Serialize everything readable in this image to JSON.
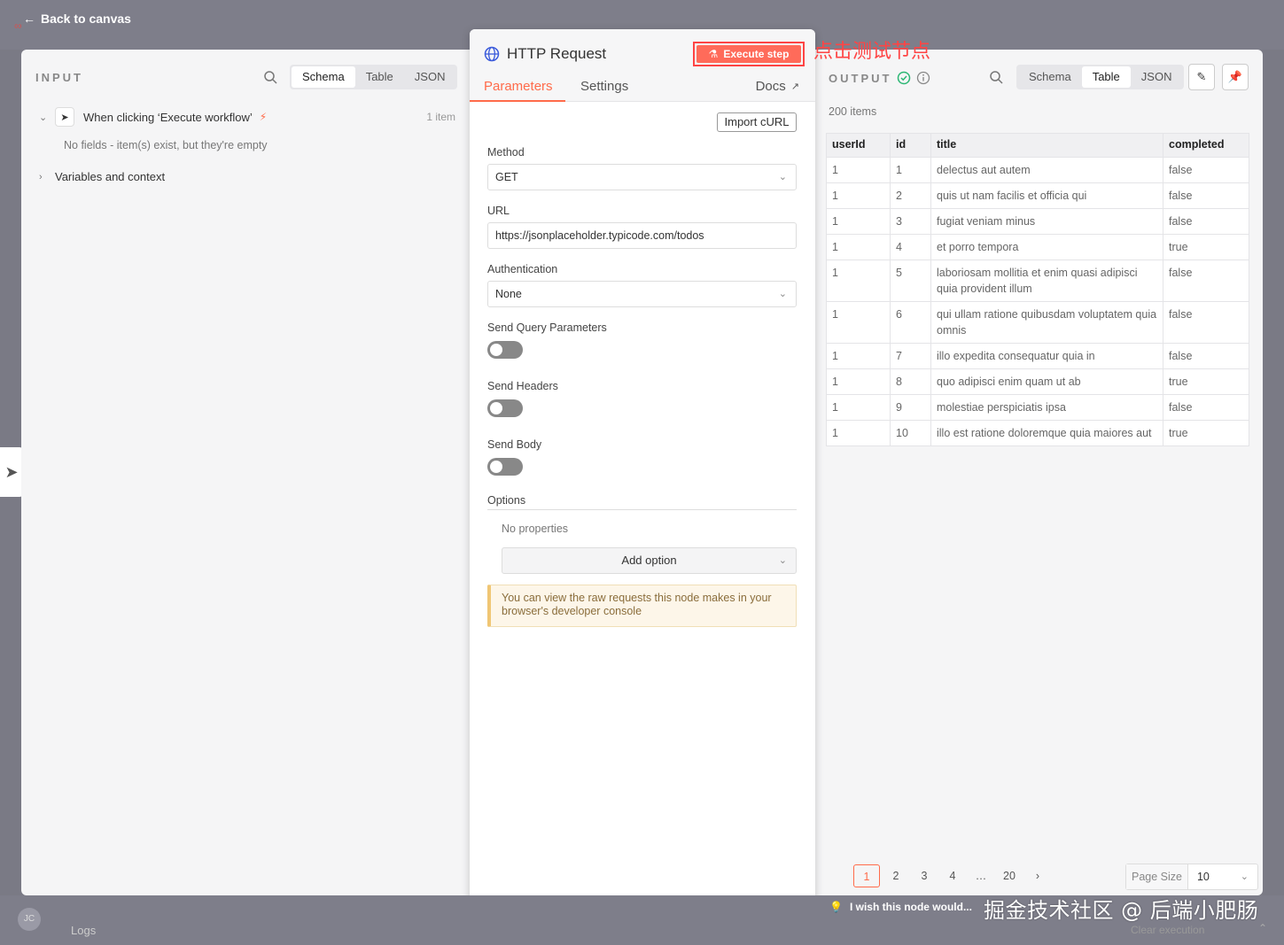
{
  "header": {
    "back_label": "Back to canvas"
  },
  "input": {
    "title": "INPUT",
    "view_options": [
      "Schema",
      "Table",
      "JSON"
    ],
    "active_view": "Schema",
    "trigger": {
      "name": "When clicking ‘Execute workflow’",
      "count": "1 item"
    },
    "empty_message": "No fields - item(s) exist, but they're empty",
    "variables_label": "Variables and context"
  },
  "node": {
    "title": "HTTP Request",
    "execute_label": "Execute step",
    "annotation": "点击测试节点",
    "tabs": {
      "parameters": "Parameters",
      "settings": "Settings",
      "docs": "Docs"
    },
    "import_curl": "Import cURL",
    "method": {
      "label": "Method",
      "value": "GET"
    },
    "url": {
      "label": "URL",
      "value": "https://jsonplaceholder.typicode.com/todos"
    },
    "auth": {
      "label": "Authentication",
      "value": "None"
    },
    "send_query": "Send Query Parameters",
    "send_headers": "Send Headers",
    "send_body": "Send Body",
    "options": {
      "label": "Options",
      "empty": "No properties",
      "add_label": "Add option"
    },
    "notice": "You can view the raw requests this node makes in your browser's developer console"
  },
  "output": {
    "title": "OUTPUT",
    "view_options": [
      "Schema",
      "Table",
      "JSON"
    ],
    "active_view": "Table",
    "count": "200 items",
    "columns": [
      "userId",
      "id",
      "title",
      "completed"
    ],
    "rows": [
      [
        "1",
        "1",
        "delectus aut autem",
        "false"
      ],
      [
        "1",
        "2",
        "quis ut nam facilis et officia qui",
        "false"
      ],
      [
        "1",
        "3",
        "fugiat veniam minus",
        "false"
      ],
      [
        "1",
        "4",
        "et porro tempora",
        "true"
      ],
      [
        "1",
        "5",
        "laboriosam mollitia et enim quasi adipisci quia provident illum",
        "false"
      ],
      [
        "1",
        "6",
        "qui ullam ratione quibusdam voluptatem quia omnis",
        "false"
      ],
      [
        "1",
        "7",
        "illo expedita consequatur quia in",
        "false"
      ],
      [
        "1",
        "8",
        "quo adipisci enim quam ut ab",
        "true"
      ],
      [
        "1",
        "9",
        "molestiae perspiciatis ipsa",
        "false"
      ],
      [
        "1",
        "10",
        "illo est ratione doloremque quia maiores aut",
        "true"
      ]
    ],
    "pager": {
      "pages": [
        "1",
        "2",
        "3",
        "4",
        "…",
        "20"
      ],
      "active": "1",
      "next": "›"
    },
    "page_size": {
      "label": "Page Size",
      "value": "10"
    }
  },
  "footer": {
    "avatar": "JC",
    "logs": "Logs",
    "wish": "I wish this node would...",
    "clear": "Clear execution",
    "watermark": "掘金技术社区 @ 后端小肥肠"
  },
  "colors": {
    "accent": "#ff6b4a",
    "execute_bg": "#ff6b5a",
    "annotation": "#ff4444",
    "success": "#2bb673"
  }
}
